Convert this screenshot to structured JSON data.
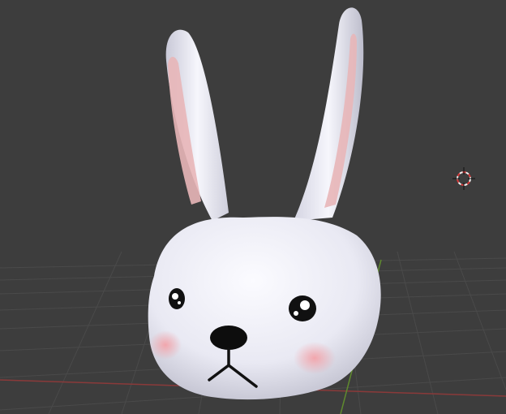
{
  "viewport": {
    "background_color": "#3d3d3d",
    "grid_color": "#4a4a4a",
    "x_axis_color": "#8a3a3a",
    "y_axis_color": "#5f8a2e"
  },
  "model": {
    "name": "bunny-head",
    "body_color": "#eeeef6",
    "inner_ear_color": "#e8b6b8",
    "cheek_color": "#f4b0b0",
    "feature_color": "#111111"
  },
  "cursor_3d": {
    "icon": "crosshair-icon",
    "ring_color_a": "#d93a3a",
    "ring_color_b": "#f0f0f0"
  }
}
